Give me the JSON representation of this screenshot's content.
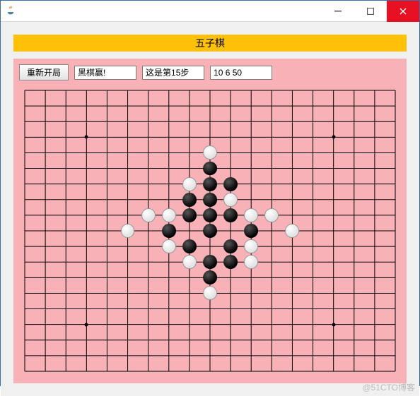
{
  "window": {
    "os_icon": "java-coffee-icon"
  },
  "banner": {
    "title": "五子棋"
  },
  "controls": {
    "restart_label": "重新开局",
    "status": "黑棋赢!",
    "move_label": "这是第15步",
    "coords": "10 6 50"
  },
  "board": {
    "size": 19,
    "star_points": [
      {
        "col": 3,
        "row": 3
      },
      {
        "col": 15,
        "row": 3
      },
      {
        "col": 9,
        "row": 9
      },
      {
        "col": 3,
        "row": 15
      },
      {
        "col": 15,
        "row": 15
      }
    ],
    "stones": [
      {
        "col": 9,
        "row": 4,
        "c": "w"
      },
      {
        "col": 9,
        "row": 5,
        "c": "b"
      },
      {
        "col": 8,
        "row": 6,
        "c": "w"
      },
      {
        "col": 9,
        "row": 6,
        "c": "b"
      },
      {
        "col": 10,
        "row": 6,
        "c": "b"
      },
      {
        "col": 8,
        "row": 7,
        "c": "b"
      },
      {
        "col": 9,
        "row": 7,
        "c": "b"
      },
      {
        "col": 10,
        "row": 7,
        "c": "w"
      },
      {
        "col": 6,
        "row": 8,
        "c": "w"
      },
      {
        "col": 7,
        "row": 8,
        "c": "w"
      },
      {
        "col": 8,
        "row": 8,
        "c": "b"
      },
      {
        "col": 9,
        "row": 8,
        "c": "b"
      },
      {
        "col": 10,
        "row": 8,
        "c": "b"
      },
      {
        "col": 11,
        "row": 8,
        "c": "w"
      },
      {
        "col": 12,
        "row": 8,
        "c": "w"
      },
      {
        "col": 5,
        "row": 9,
        "c": "w"
      },
      {
        "col": 7,
        "row": 9,
        "c": "b"
      },
      {
        "col": 9,
        "row": 9,
        "c": "b"
      },
      {
        "col": 11,
        "row": 9,
        "c": "b"
      },
      {
        "col": 13,
        "row": 9,
        "c": "w"
      },
      {
        "col": 7,
        "row": 10,
        "c": "w"
      },
      {
        "col": 8,
        "row": 10,
        "c": "b"
      },
      {
        "col": 10,
        "row": 10,
        "c": "b"
      },
      {
        "col": 11,
        "row": 10,
        "c": "w"
      },
      {
        "col": 8,
        "row": 11,
        "c": "w"
      },
      {
        "col": 9,
        "row": 11,
        "c": "b"
      },
      {
        "col": 10,
        "row": 11,
        "c": "b"
      },
      {
        "col": 11,
        "row": 11,
        "c": "w"
      },
      {
        "col": 9,
        "row": 12,
        "c": "b"
      },
      {
        "col": 9,
        "row": 13,
        "c": "w"
      }
    ]
  },
  "watermark": "@51CTO博客"
}
